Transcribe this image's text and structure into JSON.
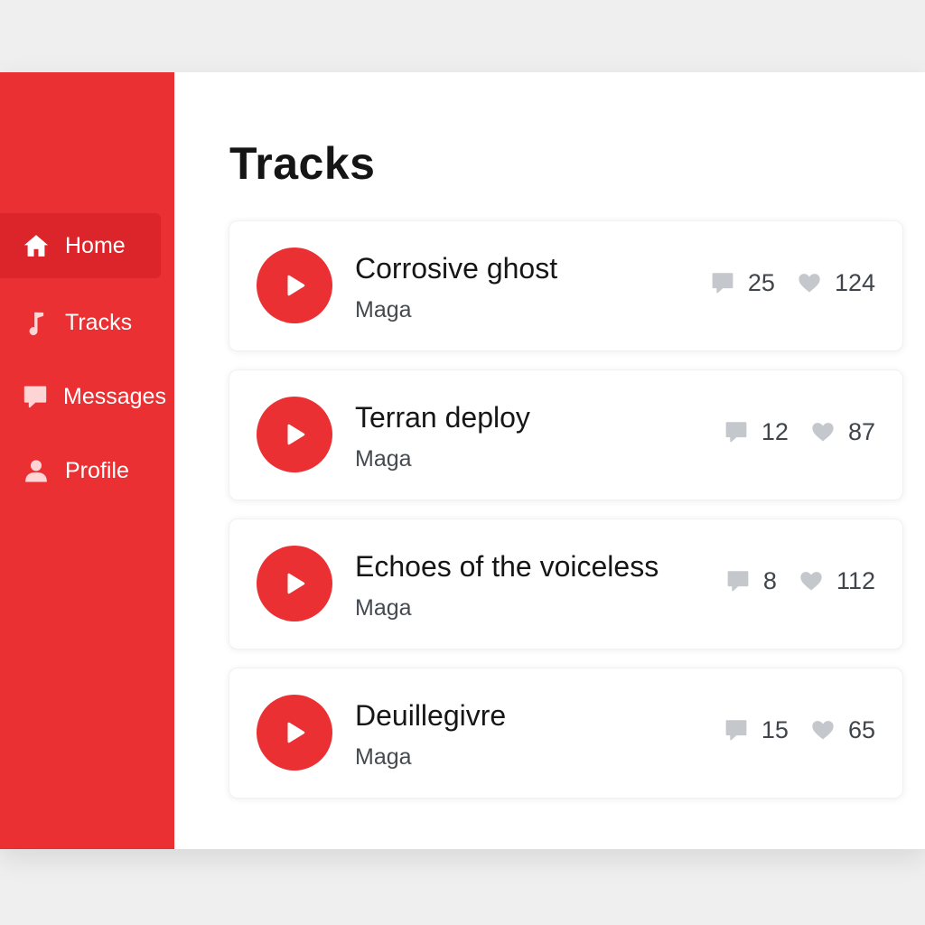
{
  "sidebar": {
    "accent": "#ea3033",
    "items": [
      {
        "label": "Home",
        "icon": "home-icon",
        "active": true
      },
      {
        "label": "Tracks",
        "icon": "music-note-icon",
        "active": false
      },
      {
        "label": "Messages",
        "icon": "chat-bubble-icon",
        "active": false
      },
      {
        "label": "Profile",
        "icon": "user-icon",
        "active": false
      }
    ]
  },
  "main": {
    "title": "Tracks",
    "tracks": [
      {
        "title": "Corrosive ghost",
        "artist": "Maga",
        "comments": "25",
        "likes": "124"
      },
      {
        "title": "Terran deploy",
        "artist": "Maga",
        "comments": "12",
        "likes": "87"
      },
      {
        "title": "Echoes of the voiceless",
        "artist": "Maga",
        "comments": "8",
        "likes": "112"
      },
      {
        "title": "Deuillegivre",
        "artist": "Maga",
        "comments": "15",
        "likes": "65"
      }
    ]
  },
  "colors": {
    "accent": "#ea3033",
    "accent_dark": "#dc252a",
    "icon_gray": "#c4c8cc"
  }
}
